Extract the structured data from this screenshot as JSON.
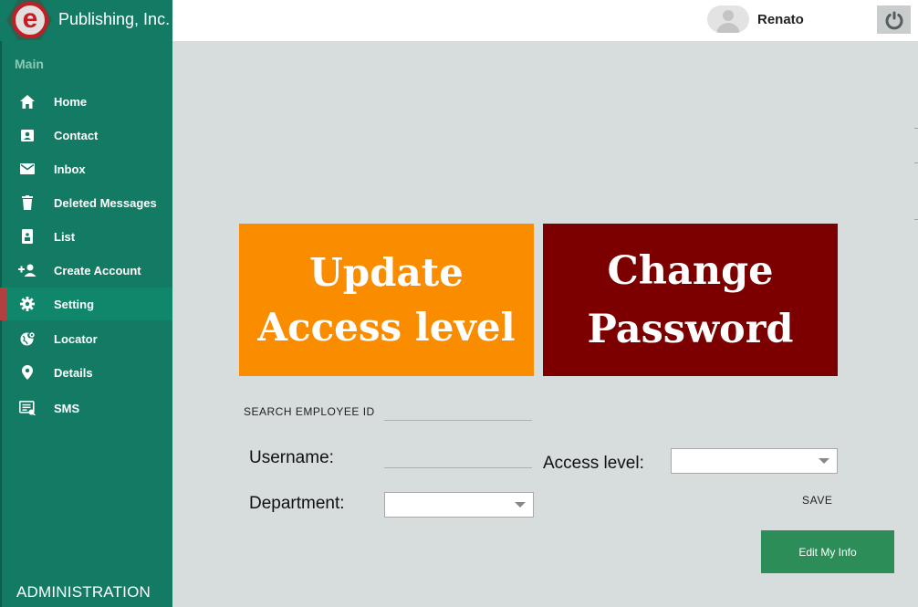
{
  "brand": {
    "name": "Publishing, Inc.",
    "logo_letter": "e"
  },
  "sidebar": {
    "section": "Main",
    "items": [
      {
        "label": "Home",
        "icon": "home-icon",
        "active": false
      },
      {
        "label": "Contact",
        "icon": "contact-card-icon",
        "active": false
      },
      {
        "label": "Inbox",
        "icon": "mail-icon",
        "active": false
      },
      {
        "label": "Deleted Messages",
        "icon": "trash-icon",
        "active": false
      },
      {
        "label": "List",
        "icon": "list-badge-icon",
        "active": false
      },
      {
        "label": "Create Account",
        "icon": "add-user-icon",
        "active": false
      },
      {
        "label": "Setting",
        "icon": "gear-icon",
        "active": true
      },
      {
        "label": "Locator",
        "icon": "globe-pin-icon",
        "active": false
      },
      {
        "label": "Details",
        "icon": "map-pin-icon",
        "active": false
      },
      {
        "label": "SMS",
        "icon": "sms-icon",
        "active": false
      }
    ],
    "footer": "ADMINISTRATION"
  },
  "topbar": {
    "user": "Renato",
    "power_icon": "power-icon"
  },
  "tiles": {
    "update": {
      "line1": "Update",
      "line2": "Access level",
      "color": "#fa8c00"
    },
    "change": {
      "line1": "Change",
      "line2": "Password",
      "color": "#7c0000"
    }
  },
  "form": {
    "search_label": "SEARCH EMPLOYEE ID",
    "search_value": "",
    "username_label": "Username:",
    "username_value": "",
    "access_label": "Access level:",
    "access_value": "",
    "department_label": "Department:",
    "department_value": "",
    "save_label": "SAVE",
    "edit_label": "Edit My Info"
  },
  "colors": {
    "sidebar": "#137a63",
    "content_bg": "#d7dcdc",
    "accent_green": "#2c8d58",
    "active_marker": "#b34040"
  }
}
